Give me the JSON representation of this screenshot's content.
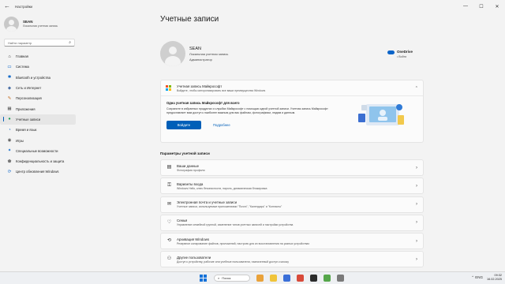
{
  "window": {
    "title": "Настройки",
    "minimize": "—",
    "maximize": "☐",
    "close": "✕"
  },
  "profile": {
    "name": "SEAN",
    "subtitle": "Локальная учетная запись"
  },
  "search": {
    "placeholder": "Найти параметр"
  },
  "nav": [
    {
      "label": "Главная",
      "icon": "home-icon",
      "glyph": "⌂",
      "color": "#333333"
    },
    {
      "label": "Система",
      "icon": "system-icon",
      "glyph": "▭",
      "color": "#0a64c8"
    },
    {
      "label": "Bluetooth и устройства",
      "icon": "bluetooth-icon",
      "glyph": "✱",
      "color": "#0a64c8"
    },
    {
      "label": "Сеть и Интернет",
      "icon": "network-icon",
      "glyph": "◆",
      "color": "#4a6fa5"
    },
    {
      "label": "Персонализация",
      "icon": "personalization-icon",
      "glyph": "✎",
      "color": "#c46a1c"
    },
    {
      "label": "Приложения",
      "icon": "apps-icon",
      "glyph": "▦",
      "color": "#555555"
    },
    {
      "label": "Учетные записи",
      "icon": "accounts-icon",
      "glyph": "●",
      "color": "#1f9e5a",
      "active": true
    },
    {
      "label": "Время и язык",
      "icon": "time-language-icon",
      "glyph": "◔",
      "color": "#0a64c8"
    },
    {
      "label": "Игры",
      "icon": "gaming-icon",
      "glyph": "◉",
      "color": "#555555"
    },
    {
      "label": "Специальные возможности",
      "icon": "accessibility-icon",
      "glyph": "✦",
      "color": "#0a64c8"
    },
    {
      "label": "Конфиденциальность и защита",
      "icon": "privacy-shield-icon",
      "glyph": "⬟",
      "color": "#777777"
    },
    {
      "label": "Центр обновления Windows",
      "icon": "windows-update-icon",
      "glyph": "⟳",
      "color": "#0a64c8"
    }
  ],
  "main": {
    "title": "Учетные записи",
    "account": {
      "name": "SEAN",
      "type": "Локальная учетная запись",
      "role": "Администратор"
    },
    "onedrive": {
      "title": "OneDrive",
      "status": "• Войти"
    },
    "ms_account": {
      "title": "Учетная запись Майкрософт",
      "subtitle": "Войдите, чтобы синхронизировать все ваши преимущества Windows",
      "body_title": "Одна учетная запись Майкрософт для всего",
      "body_text": "Сохраните в избранных продуктах и службах Майкрософт с помощью одной учетной записи. Учетная запись Майкрософт предоставляет вам доступ к наиболее важным для вас файлам, фотографиям, людям и данным.",
      "signin": "Войдите",
      "more": "Подробнее",
      "logo_colors": [
        "#f25022",
        "#7fba00",
        "#00a4ef",
        "#ffb900"
      ]
    },
    "section_title": "Параметры учетной записи",
    "rows": [
      {
        "title": "Ваши данные",
        "subtitle": "Фотография профиля",
        "icon": "user-info-icon",
        "glyph": "▤"
      },
      {
        "title": "Варианты входа",
        "subtitle": "Windows Hello, ключ безопасности, пароль, динамическая блокировка",
        "icon": "key-icon",
        "glyph": "⚿"
      },
      {
        "title": "Электронная почта и учетные записи",
        "subtitle": "Учетные записи, используемые приложениями \"Почта\", \"Календарь\" и \"Контакты\"",
        "icon": "mail-icon",
        "glyph": "✉"
      },
      {
        "title": "Семья",
        "subtitle": "Управление семейной группой, изменение типов учетных записей и настройки устройства",
        "icon": "family-icon",
        "glyph": "♡"
      },
      {
        "title": "Архивация Windows",
        "subtitle": "Резервное копирование файлов, приложений, настроек для их восстановления на разных устройствах",
        "icon": "backup-icon",
        "glyph": "⟲"
      },
      {
        "title": "Другие пользователи",
        "subtitle": "Доступ к устройству, рабочие или учебные пользователи, назначенный доступ к киоску",
        "icon": "other-users-icon",
        "glyph": "⚇"
      }
    ]
  },
  "taskbar": {
    "search_label": "Поиск",
    "tray": "⌃  ENG",
    "time": "09:32",
    "date": "16.02.2025",
    "apps": [
      {
        "name": "widgets-app-icon",
        "color": "#e9a23b"
      },
      {
        "name": "file-explorer-app-icon",
        "color": "#f0c43a"
      },
      {
        "name": "store-app-icon",
        "color": "#3a6fd8"
      },
      {
        "name": "browser-app-icon",
        "color": "#d84a3a"
      },
      {
        "name": "terminal-app-icon",
        "color": "#2b2b2b"
      },
      {
        "name": "game-app-icon",
        "color": "#55a64a"
      },
      {
        "name": "settings-app-icon",
        "color": "#7a7a7a"
      }
    ]
  }
}
